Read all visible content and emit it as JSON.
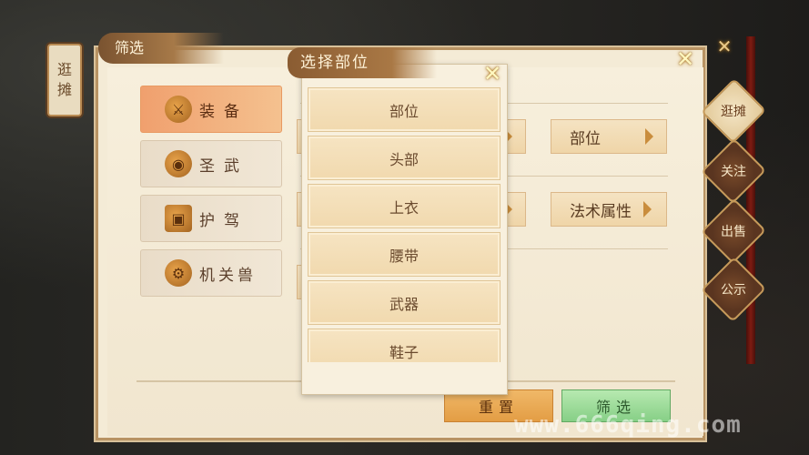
{
  "left_tab": {
    "label_1": "逛",
    "label_2": "摊"
  },
  "panel": {
    "title": "筛选"
  },
  "categories": [
    {
      "label": "装备",
      "icon": "gear-swords-icon"
    },
    {
      "label": "圣武",
      "icon": "pig-icon"
    },
    {
      "label": "护驾",
      "icon": "chest-icon"
    },
    {
      "label": "机关兽",
      "icon": "gear-icon"
    }
  ],
  "filters": {
    "row1": "部位",
    "row2": "法术属性"
  },
  "dropdown": {
    "title": "选择部位",
    "options": [
      "部位",
      "头部",
      "上衣",
      "腰带",
      "武器",
      "鞋子"
    ]
  },
  "buttons": {
    "reset": "重置",
    "confirm": "筛选"
  },
  "right_tabs": [
    "逛摊",
    "关注",
    "出售",
    "公示"
  ],
  "watermark": "www.666qing.com",
  "colors": {
    "accent": "#f0a06e",
    "confirm": "#86cf86",
    "reset": "#e39d44"
  }
}
